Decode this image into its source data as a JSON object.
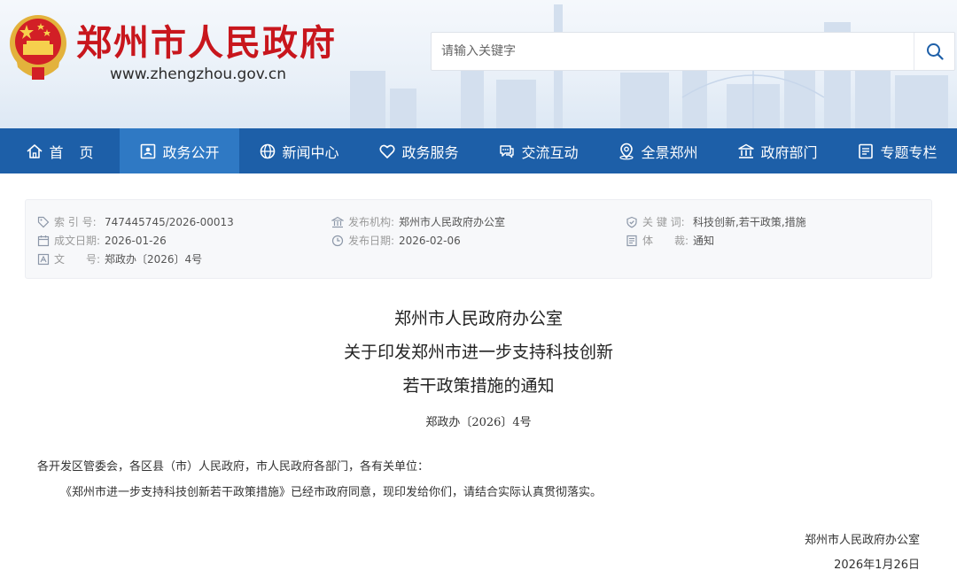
{
  "header": {
    "site_title": "郑州市人民政府",
    "site_url": "www.zhengzhou.gov.cn",
    "emblem_icon": "national-emblem-icon",
    "search": {
      "placeholder": "请输入关键字",
      "value": "",
      "button_icon": "search-icon"
    }
  },
  "colors": {
    "brand_red": "#c8161d",
    "nav_blue": "#1d5fa8",
    "nav_active": "#2f79c4"
  },
  "nav": {
    "items": [
      {
        "label": "首页",
        "icon": "home-icon",
        "active": false
      },
      {
        "label": "政务公开",
        "icon": "id-card-icon",
        "active": true
      },
      {
        "label": "新闻中心",
        "icon": "globe-icon",
        "active": false
      },
      {
        "label": "政务服务",
        "icon": "heart-icon",
        "active": false
      },
      {
        "label": "交流互动",
        "icon": "chat-icon",
        "active": false
      },
      {
        "label": "全景郑州",
        "icon": "pin-icon",
        "active": false
      },
      {
        "label": "政府部门",
        "icon": "building-icon",
        "active": false
      },
      {
        "label": "专题专栏",
        "icon": "list-icon",
        "active": false
      }
    ]
  },
  "info": {
    "index_no": {
      "key": "索 引 号:",
      "value": "747445745/2026-00013",
      "icon": "tag-icon"
    },
    "created": {
      "key": "成文日期:",
      "value": "2026-01-26",
      "icon": "calendar-icon"
    },
    "doc_no": {
      "key": "文　　号:",
      "value": "郑政办〔2026〕4号",
      "icon": "document-icon"
    },
    "publisher": {
      "key": "发布机构:",
      "value": "郑州市人民政府办公室",
      "icon": "institution-icon"
    },
    "published": {
      "key": "发布日期:",
      "value": "2026-02-06",
      "icon": "clock-icon"
    },
    "keywords": {
      "key": "关 键 词:",
      "value": "科技创新,若干政策,措施",
      "icon": "shield-icon"
    },
    "genre": {
      "key": "体　　裁:",
      "value": "通知",
      "icon": "note-icon"
    }
  },
  "document": {
    "title_lines": [
      "郑州市人民政府办公室",
      "关于印发郑州市进一步支持科技创新",
      "若干政策措施的通知"
    ],
    "number": "郑政办〔2026〕4号",
    "salutation": "各开发区管委会，各区县（市）人民政府，市人民政府各部门，各有关单位：",
    "body": "《郑州市进一步支持科技创新若干政策措施》已经市政府同意，现印发给你们，请结合实际认真贯彻落实。",
    "signature": "郑州市人民政府办公室",
    "date": "2026年1月26日"
  }
}
